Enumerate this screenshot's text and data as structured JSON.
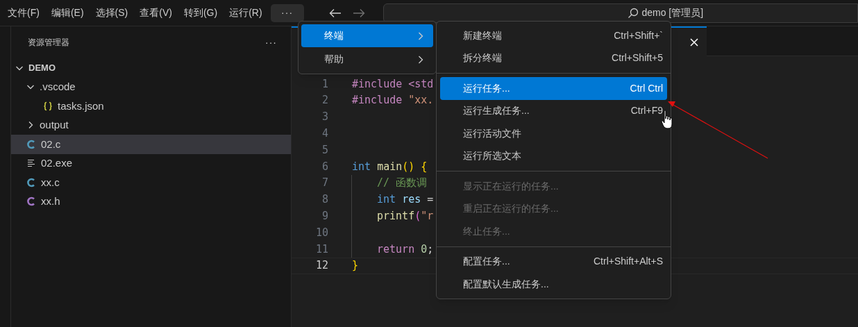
{
  "menubar": {
    "items": [
      {
        "label": "文件(F)"
      },
      {
        "label": "编辑(E)"
      },
      {
        "label": "选择(S)"
      },
      {
        "label": "查看(V)"
      },
      {
        "label": "转到(G)"
      },
      {
        "label": "运行(R)"
      }
    ],
    "overflow_label": "···"
  },
  "search": {
    "value": "demo [管理员]"
  },
  "sidebar": {
    "title": "资源管理器",
    "more_label": "···",
    "tree": [
      {
        "label": "DEMO",
        "kind": "root",
        "expanded": true,
        "selected": false,
        "children": [
          {
            "label": ".vscode",
            "kind": "folder",
            "expanded": true,
            "selected": false,
            "children": [
              {
                "label": "tasks.json",
                "kind": "json",
                "selected": false
              }
            ]
          },
          {
            "label": "output",
            "kind": "folder",
            "expanded": false,
            "selected": false
          },
          {
            "label": "02.c",
            "kind": "c",
            "selected": true
          },
          {
            "label": "02.exe",
            "kind": "text",
            "selected": false
          },
          {
            "label": "xx.c",
            "kind": "c",
            "selected": false
          },
          {
            "label": "xx.h",
            "kind": "h",
            "selected": false
          }
        ]
      }
    ]
  },
  "editor": {
    "lines": [
      {
        "number": "1",
        "indent": false,
        "current": false,
        "tokens": [
          {
            "text": "#include <std",
            "kind": "directive"
          }
        ]
      },
      {
        "number": "2",
        "indent": false,
        "current": false,
        "tokens": [
          {
            "text": "#include ",
            "kind": "directive"
          },
          {
            "text": "\"xx.",
            "kind": "string"
          }
        ]
      },
      {
        "number": "3",
        "indent": false,
        "current": false
      },
      {
        "number": "4",
        "indent": false,
        "current": false
      },
      {
        "number": "5",
        "indent": false,
        "current": false
      },
      {
        "number": "6",
        "indent": false,
        "current": false,
        "tokens": [
          {
            "text": "int ",
            "kind": "keyword"
          },
          {
            "text": "main",
            "kind": "func"
          },
          {
            "text": "() {",
            "kind": "bracket"
          }
        ]
      },
      {
        "number": "7",
        "indent": true,
        "current": false,
        "tokens": [
          {
            "text": "// 函数调",
            "kind": "comment"
          }
        ]
      },
      {
        "number": "8",
        "indent": true,
        "current": false,
        "tokens": [
          {
            "text": "int ",
            "kind": "keyword"
          },
          {
            "text": "res",
            "kind": "variable"
          },
          {
            "text": " =",
            "kind": "plain"
          }
        ]
      },
      {
        "number": "9",
        "indent": true,
        "current": false,
        "tokens": [
          {
            "text": "printf",
            "kind": "func"
          },
          {
            "text": "(",
            "kind": "bracket2"
          },
          {
            "text": "\"r",
            "kind": "string"
          }
        ]
      },
      {
        "number": "10",
        "indent": true,
        "current": false
      },
      {
        "number": "11",
        "indent": true,
        "current": false,
        "tokens": [
          {
            "text": "return ",
            "kind": "control"
          },
          {
            "text": "0",
            "kind": "number"
          },
          {
            "text": ";",
            "kind": "plain"
          }
        ]
      },
      {
        "number": "12",
        "indent": false,
        "current": true,
        "tokens": [
          {
            "text": "}",
            "kind": "bracket"
          }
        ]
      }
    ]
  },
  "overflow_menu": {
    "items": [
      {
        "label": "终端",
        "selected": true
      },
      {
        "label": "帮助",
        "selected": false
      }
    ]
  },
  "terminal_menu": {
    "groups": [
      [
        {
          "label": "新建终端",
          "shortcut": "Ctrl+Shift+`",
          "selected": false,
          "disabled": false
        },
        {
          "label": "拆分终端",
          "shortcut": "Ctrl+Shift+5",
          "selected": false,
          "disabled": false
        }
      ],
      [
        {
          "label": "运行任务...",
          "shortcut": "Ctrl Ctrl",
          "selected": true,
          "disabled": false
        },
        {
          "label": "运行生成任务...",
          "shortcut": "Ctrl+F9",
          "selected": false,
          "disabled": false
        },
        {
          "label": "运行活动文件",
          "selected": false,
          "disabled": false
        },
        {
          "label": "运行所选文本",
          "selected": false,
          "disabled": false
        }
      ],
      [
        {
          "label": "显示正在运行的任务...",
          "selected": false,
          "disabled": true
        },
        {
          "label": "重启正在运行的任务...",
          "selected": false,
          "disabled": true
        },
        {
          "label": "终止任务...",
          "selected": false,
          "disabled": true
        }
      ],
      [
        {
          "label": "配置任务...",
          "shortcut": "Ctrl+Shift+Alt+S",
          "selected": false,
          "disabled": false
        },
        {
          "label": "配置默认生成任务...",
          "selected": false,
          "disabled": false
        }
      ]
    ]
  }
}
